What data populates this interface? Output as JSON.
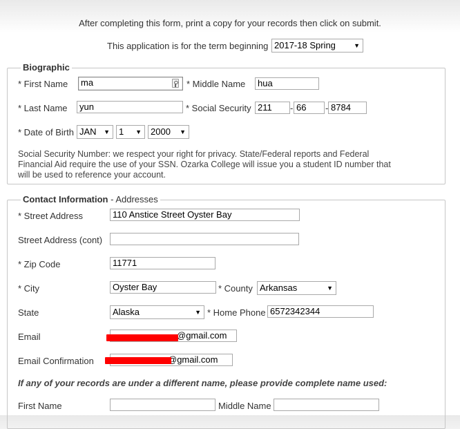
{
  "intro": {
    "instructions": "After completing this form, print a copy for your records then click on submit.",
    "term_label": "This application is for the term beginning",
    "term_value": "2017-18 Spring"
  },
  "biographic": {
    "legend": "Biographic",
    "first_name_label": "* First Name",
    "first_name_value": "ma",
    "middle_name_label": "* Middle Name",
    "middle_name_value": "hua",
    "last_name_label": "* Last Name",
    "last_name_value": "yun",
    "ssn_label": "* Social Security",
    "ssn_part1": "211",
    "ssn_part2": "66",
    "ssn_part3": "8784",
    "ssn_sep": "-",
    "dob_label": "* Date of Birth",
    "dob_month": "JAN",
    "dob_day": "1",
    "dob_year": "2000",
    "privacy_line1": "Social Security Number: we respect your right for privacy. State/Federal reports and Federal",
    "privacy_line2": "Financial Aid require the use of your SSN. Ozarka College will issue you a student ID number that",
    "privacy_line3": "will be used to reference your account."
  },
  "contact": {
    "legend_bold": "Contact Information",
    "legend_rest": " - Addresses",
    "street_label": "* Street Address",
    "street_value": "110 Anstice Street Oyster Bay",
    "street_cont_label": "Street Address (cont)",
    "street_cont_value": "",
    "zip_label": "* Zip Code",
    "zip_value": "11771",
    "city_label": "* City",
    "city_value": "Oyster Bay",
    "county_label": "* County",
    "county_value": "Arkansas",
    "state_label": "State",
    "state_value": "Alaska",
    "home_phone_label": "* Home Phone",
    "home_phone_value": "6572342344",
    "email_label": "Email",
    "email_value": "@gmail.com",
    "email_confirm_label": "Email Confirmation",
    "email_confirm_value": "@gmail.com",
    "other_name_note": "If any of your records are under a different name, please provide complete name used:",
    "prev_first_label": "First Name",
    "prev_first_value": "",
    "prev_middle_label": "Middle Name",
    "prev_middle_value": ""
  },
  "colors": {
    "redaction": "#ff0000",
    "border": "#c6c6c6"
  },
  "icons": {
    "autofill": "key-icon",
    "dropdown": "chevron-down-icon"
  }
}
